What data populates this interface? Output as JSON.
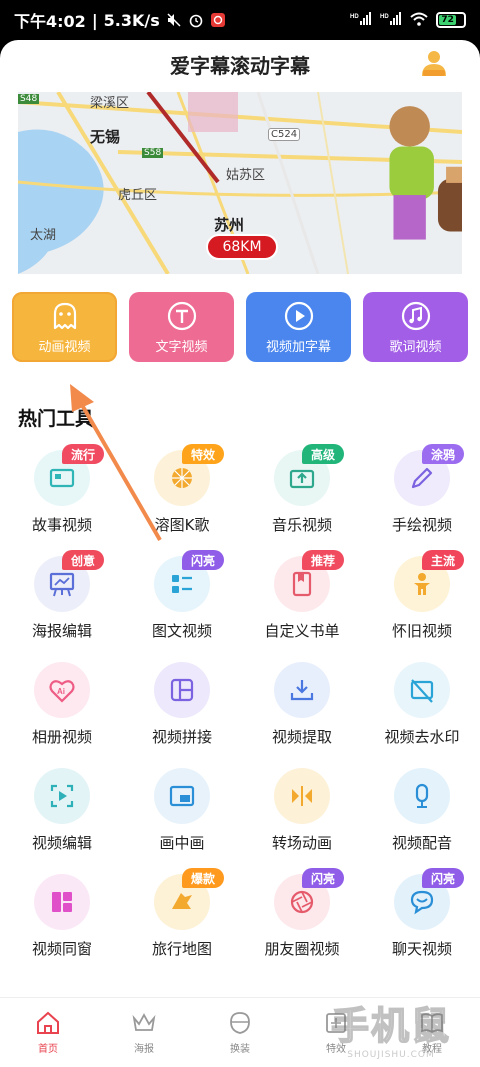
{
  "status_bar": {
    "time": "下午4:02",
    "speed": "5.3K/s",
    "battery": "72"
  },
  "header": {
    "title": "爱字幕滚动字幕"
  },
  "map": {
    "labels": [
      "梁溪区",
      "无锡",
      "虎丘区",
      "姑苏区",
      "苏州",
      "太湖",
      "C524",
      "S58",
      "S48"
    ],
    "distance": "68KM"
  },
  "features": [
    {
      "label": "动画视频",
      "icon": "ghost-icon",
      "color": "#f7b733"
    },
    {
      "label": "文字视频",
      "icon": "text-icon",
      "color": "#ee6b93"
    },
    {
      "label": "视频加字幕",
      "icon": "play-icon",
      "color": "#4a86ee"
    },
    {
      "label": "歌词视频",
      "icon": "music-icon",
      "color": "#a35ee8"
    }
  ],
  "section": {
    "title": "热门工具"
  },
  "tools": [
    {
      "label": "故事视频",
      "badge": "流行",
      "icon": "story-icon"
    },
    {
      "label": "溶图K歌",
      "badge": "特效",
      "icon": "lemon-icon"
    },
    {
      "label": "音乐视频",
      "badge": "高级",
      "icon": "upload-icon"
    },
    {
      "label": "手绘视频",
      "badge": "涂鸦",
      "icon": "pen-icon"
    },
    {
      "label": "海报编辑",
      "badge": "创意",
      "icon": "easel-icon"
    },
    {
      "label": "图文视频",
      "badge": "闪亮",
      "icon": "list-icon"
    },
    {
      "label": "自定义书单",
      "badge": "推荐",
      "icon": "book-icon"
    },
    {
      "label": "怀旧视频",
      "badge": "主流",
      "icon": "person-icon"
    },
    {
      "label": "相册视频",
      "badge": "",
      "icon": "ai-heart-icon"
    },
    {
      "label": "视频拼接",
      "badge": "",
      "icon": "grid-icon"
    },
    {
      "label": "视频提取",
      "badge": "",
      "icon": "download-icon"
    },
    {
      "label": "视频去水印",
      "badge": "",
      "icon": "no-watermark-icon"
    },
    {
      "label": "视频编辑",
      "badge": "",
      "icon": "edit-video-icon"
    },
    {
      "label": "画中画",
      "badge": "",
      "icon": "pip-icon"
    },
    {
      "label": "转场动画",
      "badge": "",
      "icon": "transition-icon"
    },
    {
      "label": "视频配音",
      "badge": "",
      "icon": "mic-icon"
    },
    {
      "label": "视频同窗",
      "badge": "",
      "icon": "split-window-icon"
    },
    {
      "label": "旅行地图",
      "badge": "爆款",
      "icon": "travel-icon"
    },
    {
      "label": "朋友圈视频",
      "badge": "闪亮",
      "icon": "aperture-icon"
    },
    {
      "label": "聊天视频",
      "badge": "闪亮",
      "icon": "chat-icon"
    }
  ],
  "bottom_nav": [
    {
      "label": "首页",
      "icon": "home-icon",
      "active": true
    },
    {
      "label": "海报",
      "icon": "crown-icon",
      "active": false
    },
    {
      "label": "换装",
      "icon": "cloth-icon",
      "active": false
    },
    {
      "label": "特效",
      "icon": "effect-icon",
      "active": false
    },
    {
      "label": "教程",
      "icon": "book-nav-icon",
      "active": false
    }
  ],
  "watermark": {
    "main": "手机鼠",
    "sub": "SHOUJISHU.COM"
  }
}
